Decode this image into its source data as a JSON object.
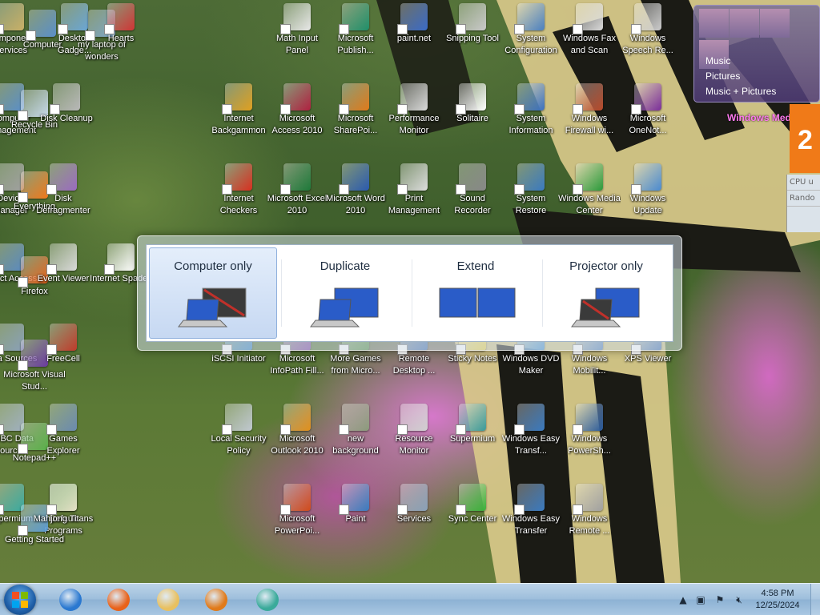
{
  "desktop": {
    "icons": [
      {
        "label": "Component Services",
        "color": "#c9b067"
      },
      {
        "label": "Computer",
        "color": "#5a8fc9"
      },
      {
        "label": "Desktop Gadge...",
        "color": "#6aa6d6"
      },
      {
        "label": "my laptop of wonders",
        "color": "#7da6c8"
      },
      {
        "label": "Hearts",
        "color": "#d03535"
      },
      {
        "label": "Math Input Panel",
        "color": "#e8e8e8"
      },
      {
        "label": "Microsoft Publish...",
        "color": "#1f8f6a"
      },
      {
        "label": "paint.net",
        "color": "#3a6bc7"
      },
      {
        "label": "Snipping Tool",
        "color": "#c9c9c9"
      },
      {
        "label": "System Configuration",
        "color": "#4a7fc0"
      },
      {
        "label": "Windows Fax and Scan",
        "color": "#d9d9d9"
      },
      {
        "label": "Windows Speech Re...",
        "color": "#cccccc"
      },
      {
        "label": "Computer Management",
        "color": "#5a8fc9"
      },
      {
        "label": "Recycle Bin",
        "color": "#c6d8ea"
      },
      {
        "label": "Disk Cleanup",
        "color": "#b8b8b8"
      },
      {
        "label": "Internet Backgammon",
        "color": "#e0a020"
      },
      {
        "label": "Microsoft Access 2010",
        "color": "#b02040"
      },
      {
        "label": "Microsoft SharePoi...",
        "color": "#e07a1a"
      },
      {
        "label": "Performance Monitor",
        "color": "#d9d9d9"
      },
      {
        "label": "Solitaire",
        "color": "#ffffff"
      },
      {
        "label": "System Information",
        "color": "#3a6fbf"
      },
      {
        "label": "Windows Firewall wi...",
        "color": "#b84a2a"
      },
      {
        "label": "Microsoft OneNot...",
        "color": "#7a2d9a"
      },
      {
        "label": "Device Manager",
        "color": "#a0a0a0"
      },
      {
        "label": "Everything",
        "color": "#f0781a"
      },
      {
        "label": "Disk Defragmenter",
        "color": "#9a6ac0"
      },
      {
        "label": "Internet Checkers",
        "color": "#d83020"
      },
      {
        "label": "Microsoft Excel 2010",
        "color": "#1e7a3a"
      },
      {
        "label": "Microsoft Word 2010",
        "color": "#2a5ab0"
      },
      {
        "label": "Print Management",
        "color": "#dcdcdc"
      },
      {
        "label": "Sound Recorder",
        "color": "#888888"
      },
      {
        "label": "System Restore",
        "color": "#3a7ac0"
      },
      {
        "label": "Windows Media Center",
        "color": "#2a9a3a"
      },
      {
        "label": "Windows Update",
        "color": "#4a8ad0"
      },
      {
        "label": "Direct Access",
        "color": "#5a8ac0"
      },
      {
        "label": "Firefox",
        "color": "#e8621a"
      },
      {
        "label": "Event Viewer",
        "color": "#d9d9d9"
      },
      {
        "label": "Internet Spades",
        "color": "#ffffff"
      },
      {
        "label": "Data Sources",
        "color": "#8aa0b8"
      },
      {
        "label": "Microsoft Visual Stud...",
        "color": "#6a3aa0"
      },
      {
        "label": "FreeCell",
        "color": "#c03a2a"
      },
      {
        "label": "iSCSI Initiator",
        "color": "#2a7ac0"
      },
      {
        "label": "Microsoft InfoPath Fill...",
        "color": "#7a3aa0"
      },
      {
        "label": "More Games from Micro...",
        "color": "#4a8a3a"
      },
      {
        "label": "Remote Desktop ...",
        "color": "#3a6ab0"
      },
      {
        "label": "Sticky Notes",
        "color": "#e8d040"
      },
      {
        "label": "Windows DVD Maker",
        "color": "#3a8ad0"
      },
      {
        "label": "Windows Mobilit...",
        "color": "#4a7ab8"
      },
      {
        "label": "XPS Viewer",
        "color": "#3a6ab0"
      },
      {
        "label": "ODBC Data Sources",
        "color": "#a0b0c0"
      },
      {
        "label": "Notepad++",
        "color": "#5ab04a"
      },
      {
        "label": "Games Explorer",
        "color": "#6a8ab0"
      },
      {
        "label": "Local Security Policy",
        "color": "#c0c8d0"
      },
      {
        "label": "Microsoft Outlook 2010",
        "color": "#e0901a"
      },
      {
        "label": "new background",
        "color": "#8a9a7a"
      },
      {
        "label": "Resource Monitor",
        "color": "#d0d0d0"
      },
      {
        "label": "Supermium",
        "color": "#3a9a9a"
      },
      {
        "label": "Windows Easy Transf...",
        "color": "#3a7ac0"
      },
      {
        "label": "Windows PowerSh...",
        "color": "#2a5a9a"
      },
      {
        "label": "Default Programs",
        "color": "#3aa03a"
      },
      {
        "label": "Supermium",
        "color": "#3aaaa0"
      },
      {
        "label": "Getting Started",
        "color": "#5a9ad0"
      },
      {
        "label": "Mahjong Titans",
        "color": "#e8e0c8"
      },
      {
        "label": "Microsoft PowerPoi...",
        "color": "#d04a1a"
      },
      {
        "label": "Paint",
        "color": "#3a7ac0"
      },
      {
        "label": "Services",
        "color": "#8aa0b8"
      },
      {
        "label": "Sync Center",
        "color": "#3ab03a"
      },
      {
        "label": "Windows Easy Transfer",
        "color": "#3a7ac0"
      },
      {
        "label": "Windows Remote ...",
        "color": "#a0a0a0"
      }
    ]
  },
  "gadgets": {
    "media_center": {
      "items": [
        "Music",
        "Pictures",
        "Music + Pictures"
      ],
      "caption": "Windows Media Ce"
    },
    "calendar_digit": "2",
    "cpu_text": "CPU u",
    "rand_text": "Rando"
  },
  "projector_switcher": {
    "options": [
      {
        "label": "Computer only",
        "selected": true
      },
      {
        "label": "Duplicate",
        "selected": false
      },
      {
        "label": "Extend",
        "selected": false
      },
      {
        "label": "Projector only",
        "selected": false
      }
    ]
  },
  "taskbar": {
    "pinned": [
      {
        "name": "internet-explorer",
        "color": "#2a78d0"
      },
      {
        "name": "firefox",
        "color": "#e8621a"
      },
      {
        "name": "windows-explorer",
        "color": "#e8c060"
      },
      {
        "name": "media-player",
        "color": "#e07a1a"
      },
      {
        "name": "supermium",
        "color": "#3aaa9a"
      }
    ],
    "clock": {
      "time": "4:58 PM",
      "date": "12/25/2024"
    }
  },
  "colors": {
    "taskbar": "#9ebfdc",
    "selected_option": "#c6d8f2",
    "monitor_blue": "#2a5cc8"
  }
}
